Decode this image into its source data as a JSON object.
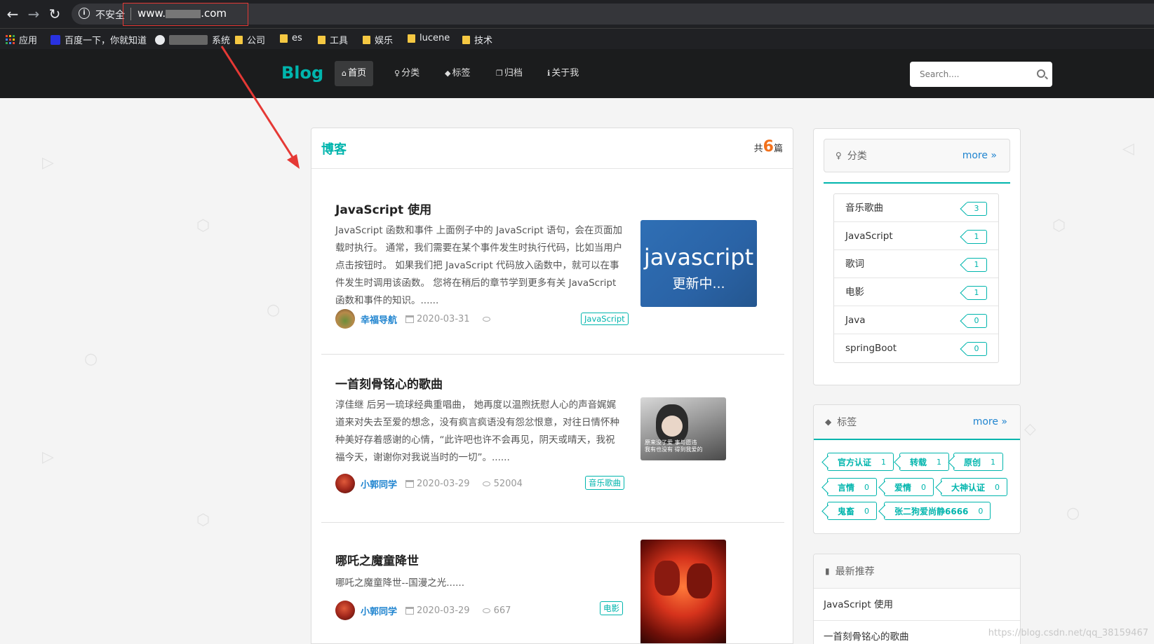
{
  "browser": {
    "insecure_label": "不安全",
    "url": "www.",
    "url_suffix": ".com",
    "bookmarks": [
      "应用",
      "百度一下，你就知道",
      "系统",
      "公司",
      "es",
      "工具",
      "娱乐",
      "lucene",
      "技术"
    ]
  },
  "site": {
    "logo": "Blog",
    "nav": [
      "首页",
      "分类",
      "标签",
      "归档",
      "关于我"
    ],
    "search_placeholder": "Search....",
    "accent_color": "#00b5ad"
  },
  "main": {
    "title": "博客",
    "count_prefix": "共",
    "count": "6",
    "count_suffix": "篇",
    "posts": [
      {
        "title": "JavaScript 使用",
        "desc": "JavaScript 函数和事件 上面例子中的 JavaScript 语句，会在页面加载时执行。 通常，我们需要在某个事件发生时执行代码，比如当用户点击按钮时。 如果我们把 JavaScript 代码放入函数中，就可以在事件发生时调用该函数。 您将在稍后的章节学到更多有关 JavaScript 函数和事件的知识。......",
        "author": "幸福导航",
        "date": "2020-03-31",
        "views": "",
        "tag": "JavaScript",
        "thumb_text_1": "javascript",
        "thumb_text_2": "更新中..."
      },
      {
        "title": "一首刻骨铭心的歌曲",
        "desc": "淳佳继 后另一琉球经典重唱曲， 她再度以温煦抚慰人心的声音娓娓道来对失去至爱的想念，没有疯言疯语没有怨忿恨意，对往日情怀种种美好存着感谢的心情，“此许吧也许不会再见，阴天或晴天，我祝福今天，谢谢你对我说当时的一切”。......",
        "author": "小郭同学",
        "date": "2020-03-29",
        "views": "52004",
        "tag": "音乐歌曲",
        "thumb_text_1": "原来没了爱 事与愿违",
        "thumb_text_2": "我有也没有 得到我爱的"
      },
      {
        "title": "哪吒之魔童降世",
        "desc": "哪吒之魔童降世--国漫之光......",
        "author": "小郭同学",
        "date": "2020-03-29",
        "views": "667",
        "tag": "电影"
      }
    ]
  },
  "sidebar": {
    "categories_title": "分类",
    "more": "more",
    "categories": [
      {
        "name": "音乐歌曲",
        "count": "3"
      },
      {
        "name": "JavaScript",
        "count": "1"
      },
      {
        "name": "歌词",
        "count": "1"
      },
      {
        "name": "电影",
        "count": "1"
      },
      {
        "name": "Java",
        "count": "0"
      },
      {
        "name": "springBoot",
        "count": "0"
      }
    ],
    "tags_title": "标签",
    "tags": [
      {
        "name": "官方认证",
        "count": "1"
      },
      {
        "name": "转载",
        "count": "1"
      },
      {
        "name": "原创",
        "count": "1"
      },
      {
        "name": "言情",
        "count": "0"
      },
      {
        "name": "爱情",
        "count": "0"
      },
      {
        "name": "大神认证",
        "count": "0"
      },
      {
        "name": "鬼畜",
        "count": "0"
      },
      {
        "name": "张二狗爱尚静6666",
        "count": "0"
      }
    ],
    "recommend_title": "最新推荐",
    "recommend": [
      "JavaScript 使用",
      "一首刻骨铭心的歌曲"
    ]
  },
  "watermark": "https://blog.csdn.net/qq_38159467"
}
